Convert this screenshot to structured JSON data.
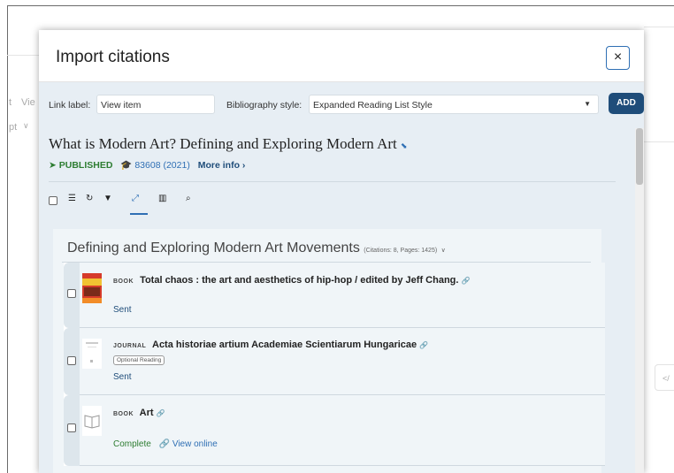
{
  "background": {
    "fragment_left_1": "t",
    "fragment_left_2": "Vie",
    "fragment_left_3": "pt",
    "right_button": "</"
  },
  "modal": {
    "title": "Import citations",
    "close_label": "×"
  },
  "settings": {
    "link_label_caption": "Link label:",
    "link_label_value": "View item",
    "bibliography_caption": "Bibliography style:",
    "bibliography_value": "Expanded Reading List Style",
    "add_label": "ADD"
  },
  "reading_list": {
    "title": "What is Modern Art? Defining and Exploring Modern Art",
    "status": "PUBLISHED",
    "stats": "83608 (2021)",
    "more_info": "More info"
  },
  "toolbar": {
    "icons": [
      "checkbox",
      "list-icon",
      "refresh-icon",
      "filter-icon",
      "expand-icon",
      "chart-icon",
      "search-icon"
    ]
  },
  "section": {
    "title": "Defining and Exploring Modern Art Movements",
    "meta": "(Citations: 8, Pages: 1425)"
  },
  "items": [
    {
      "type": "BOOK",
      "title": "Total chaos : the art and aesthetics of hip-hop / edited by Jeff Chang.",
      "status": "Sent"
    },
    {
      "type": "JOURNAL",
      "title": "Acta historiae artium Academiae Scientiarum Hungaricae",
      "badge": "Optional Reading",
      "status": "Sent"
    },
    {
      "type": "BOOK",
      "title": "Art",
      "status": "Complete",
      "link": "View online"
    }
  ],
  "colors": {
    "accent": "#2f6fb4",
    "primary_dark": "#1f4d7a",
    "published_green": "#2e7d32",
    "panel_bg": "#e7eef4"
  }
}
